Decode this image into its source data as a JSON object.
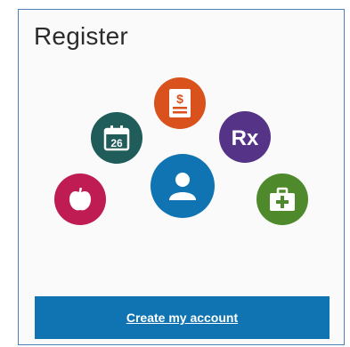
{
  "card": {
    "title": "Register",
    "cta_label": "Create my account"
  },
  "icons": [
    {
      "name": "bill-icon",
      "color": "#d9511c"
    },
    {
      "name": "calendar-icon",
      "color": "#1f5c5a",
      "text": "26"
    },
    {
      "name": "prescription-icon",
      "color": "#553487",
      "text": "Rx"
    },
    {
      "name": "user-icon",
      "color": "#0f74b1"
    },
    {
      "name": "apple-icon",
      "color": "#c01c54"
    },
    {
      "name": "medical-kit-icon",
      "color": "#4e8a2c"
    }
  ],
  "colors": {
    "accent": "#0f74b1",
    "border": "#4d7fb8"
  }
}
